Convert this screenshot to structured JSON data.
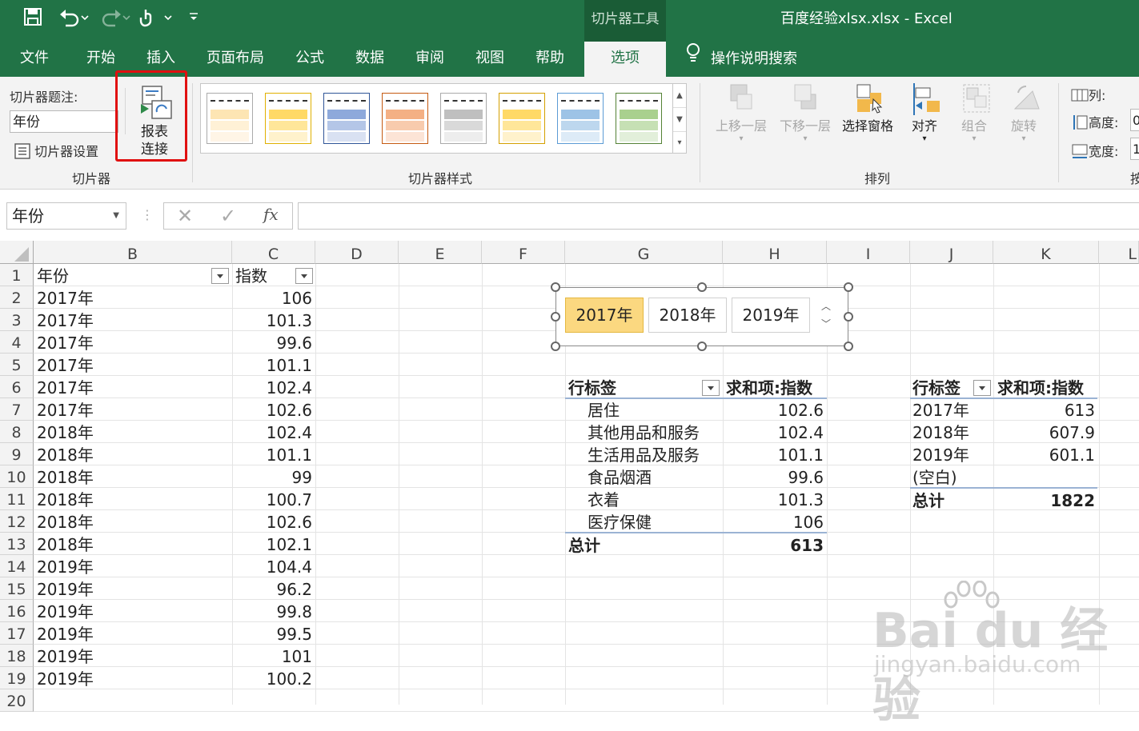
{
  "app": {
    "title": "百度经验xlsx.xlsx  -  Excel",
    "context_tab": "切片器工具",
    "accent": "#217346"
  },
  "tabs": [
    "文件",
    "开始",
    "插入",
    "页面布局",
    "公式",
    "数据",
    "审阅",
    "视图",
    "帮助",
    "选项"
  ],
  "active_tab": "选项",
  "tell_me": "操作说明搜索",
  "ribbon": {
    "slicer_group": {
      "caption_label": "切片器题注:",
      "caption_value": "年份",
      "settings_label": "切片器设置",
      "report_conn_line1": "报表",
      "report_conn_line2": "连接",
      "group_label": "切片器"
    },
    "styles_group": {
      "group_label": "切片器样式"
    },
    "arrange_group": {
      "bring_forward": "上移一层",
      "send_backward": "下移一层",
      "selection_pane": "选择窗格",
      "align": "对齐",
      "group": "组合",
      "rotate": "旋转",
      "group_label": "排列"
    },
    "size_group": {
      "columns": "列:",
      "height": "高度:",
      "width": "宽度:",
      "height_value": "0",
      "width_value": "1",
      "group_label_partial": "按"
    }
  },
  "formula_bar": {
    "name_box": "年份",
    "fx": "fx",
    "value": ""
  },
  "columns": [
    "B",
    "C",
    "D",
    "E",
    "F",
    "G",
    "H",
    "I",
    "J",
    "K",
    "L"
  ],
  "rows": [
    "1",
    "2",
    "3",
    "4",
    "5",
    "6",
    "7",
    "8",
    "9",
    "10",
    "11",
    "12",
    "13",
    "14",
    "15",
    "16",
    "17",
    "18",
    "19",
    "20"
  ],
  "table": {
    "header_year": "年份",
    "header_index": "指数",
    "data": [
      [
        "2017年",
        "106"
      ],
      [
        "2017年",
        "101.3"
      ],
      [
        "2017年",
        "99.6"
      ],
      [
        "2017年",
        "101.1"
      ],
      [
        "2017年",
        "102.4"
      ],
      [
        "2017年",
        "102.6"
      ],
      [
        "2018年",
        "102.4"
      ],
      [
        "2018年",
        "101.1"
      ],
      [
        "2018年",
        "99"
      ],
      [
        "2018年",
        "100.7"
      ],
      [
        "2018年",
        "102.6"
      ],
      [
        "2018年",
        "102.1"
      ],
      [
        "2019年",
        "104.4"
      ],
      [
        "2019年",
        "96.2"
      ],
      [
        "2019年",
        "99.8"
      ],
      [
        "2019年",
        "99.5"
      ],
      [
        "2019年",
        "101"
      ],
      [
        "2019年",
        "100.2"
      ]
    ]
  },
  "slicer": {
    "items": [
      "2017年",
      "2018年",
      "2019年"
    ],
    "selected": "2017年"
  },
  "pivot1": {
    "header_label": "行标签",
    "header_value": "求和项:指数",
    "rows": [
      [
        "居住",
        "102.6"
      ],
      [
        "其他用品和服务",
        "102.4"
      ],
      [
        "生活用品及服务",
        "101.1"
      ],
      [
        "食品烟酒",
        "99.6"
      ],
      [
        "衣着",
        "101.3"
      ],
      [
        "医疗保健",
        "106"
      ]
    ],
    "total_label": "总计",
    "total_value": "613"
  },
  "pivot2": {
    "header_label": "行标签",
    "header_value": "求和项:指数",
    "rows": [
      [
        "2017年",
        "613"
      ],
      [
        "2018年",
        "607.9"
      ],
      [
        "2019年",
        "601.1"
      ],
      [
        "(空白)",
        ""
      ]
    ],
    "total_label": "总计",
    "total_value": "1822"
  },
  "watermark": {
    "brand": "Bai du 经验",
    "url": "jingyan.baidu.com"
  }
}
